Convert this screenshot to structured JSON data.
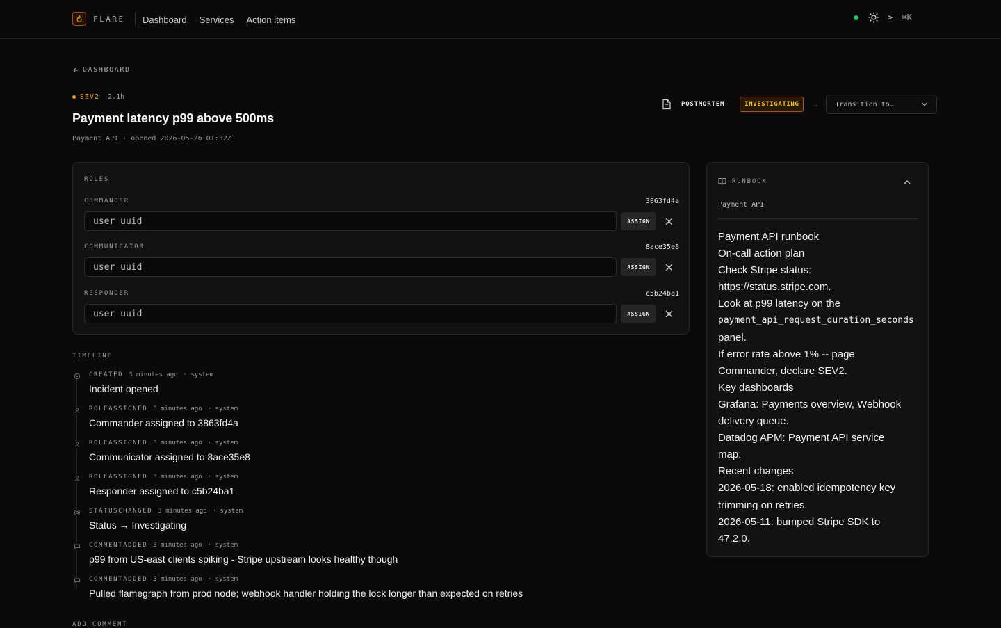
{
  "nav": {
    "brand": "FLARE",
    "links": [
      "Dashboard",
      "Services",
      "Action items"
    ],
    "kbd": "⌘K"
  },
  "header": {
    "back_label": "DASHBOARD",
    "severity": "SEV2",
    "age": "2.1h",
    "title": "Payment latency p99 above 500ms",
    "subtitle": "Payment API · opened 2026-05-26 01:32Z",
    "postmortem_label": "POSTMORTEM",
    "status": "INVESTIGATING",
    "transition_placeholder": "Transition to…"
  },
  "roles": {
    "label": "ROLES",
    "assign_label": "ASSIGN",
    "items": [
      {
        "name": "COMMANDER",
        "id": "3863fd4a",
        "placeholder": "user uuid"
      },
      {
        "name": "COMMUNICATOR",
        "id": "8ace35e8",
        "placeholder": "user uuid"
      },
      {
        "name": "RESPONDER",
        "id": "c5b24ba1",
        "placeholder": "user uuid"
      }
    ]
  },
  "timeline": {
    "label": "TIMELINE",
    "items": [
      {
        "kind": "CREATED",
        "time": "3 minutes ago",
        "who": "· system",
        "text": "Incident opened",
        "icon": "created-icon"
      },
      {
        "kind": "ROLEASSIGNED",
        "time": "3 minutes ago",
        "who": "· system",
        "text": "Commander assigned to 3863fd4a",
        "icon": "user-icon"
      },
      {
        "kind": "ROLEASSIGNED",
        "time": "3 minutes ago",
        "who": "· system",
        "text": "Communicator assigned to 8ace35e8",
        "icon": "user-icon"
      },
      {
        "kind": "ROLEASSIGNED",
        "time": "3 minutes ago",
        "who": "· system",
        "text": "Responder assigned to c5b24ba1",
        "icon": "user-icon"
      },
      {
        "kind": "STATUSCHANGED",
        "time": "3 minutes ago",
        "who": "· system",
        "text": "Status → Investigating",
        "icon": "status-icon"
      },
      {
        "kind": "COMMENTADDED",
        "time": "3 minutes ago",
        "who": "· system",
        "text": "p99 from US-east clients spiking - Stripe upstream looks healthy though",
        "icon": "comment-icon"
      },
      {
        "kind": "COMMENTADDED",
        "time": "3 minutes ago",
        "who": "· system",
        "text": "Pulled flamegraph from prod node; webhook handler holding the lock longer than expected on retries",
        "icon": "comment-icon"
      }
    ],
    "add_comment_label": "ADD COMMENT"
  },
  "runbook": {
    "label": "RUNBOOK",
    "service": "Payment API",
    "lines": [
      "Payment API runbook",
      "On-call action plan",
      "Check Stripe status:",
      "https://status.stripe.com.",
      "Look at p99 latency on the",
      "payment_api_request_duration_seconds",
      "panel.",
      "If error rate above 1% -- page",
      "Commander, declare SEV2.",
      "Key dashboards",
      "Grafana: Payments overview, Webhook",
      "delivery queue.",
      "Datadog APM: Payment API service",
      "map.",
      "Recent changes",
      "2026-05-18: enabled idempotency key",
      "trimming on retries.",
      "2026-05-11: bumped Stripe SDK to",
      "47.2.0."
    ]
  },
  "colors": {
    "accent": "#f59e0b",
    "status_ok": "#22c55e",
    "badge_bg": "#271a05"
  }
}
